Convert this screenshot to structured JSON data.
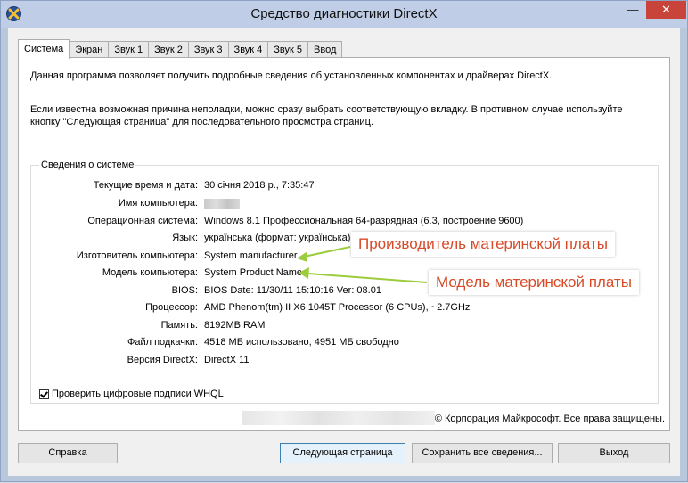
{
  "window": {
    "title": "Средство диагностики DirectX",
    "minimize_glyph": "—",
    "close_glyph": "✕"
  },
  "tabs": [
    {
      "label": "Система"
    },
    {
      "label": "Экран"
    },
    {
      "label": "Звук 1"
    },
    {
      "label": "Звук 2"
    },
    {
      "label": "Звук 3"
    },
    {
      "label": "Звук 4"
    },
    {
      "label": "Звук 5"
    },
    {
      "label": "Ввод"
    }
  ],
  "intro": {
    "line1": "Данная программа позволяет получить подробные сведения об установленных компонентах и драйверах DirectX.",
    "line2": "Если известна возможная причина неполадки, можно сразу выбрать соответствующую вкладку. В противном случае используйте кнопку \"Следующая страница\" для последовательного просмотра страниц."
  },
  "system_info": {
    "group_label": "Сведения о системе",
    "rows": [
      {
        "label": "Текущие время и дата:",
        "value": "30 січня 2018 р., 7:35:47"
      },
      {
        "label": "Имя компьютера:",
        "value": ""
      },
      {
        "label": "Операционная система:",
        "value": "Windows 8.1 Профессиональная 64-разрядная (6.3, построение 9600)"
      },
      {
        "label": "Язык:",
        "value": "українська (формат: українська)"
      },
      {
        "label": "Изготовитель компьютера:",
        "value": "System manufacturer"
      },
      {
        "label": "Модель компьютера:",
        "value": "System Product Name"
      },
      {
        "label": "BIOS:",
        "value": "BIOS Date: 11/30/11 15:10:16 Ver: 08.01"
      },
      {
        "label": "Процессор:",
        "value": "AMD Phenom(tm) II X6 1045T Processor (6 CPUs), ~2.7GHz"
      },
      {
        "label": "Память:",
        "value": "8192MB RAM"
      },
      {
        "label": "Файл подкачки:",
        "value": "4518 МБ использовано, 4951 МБ свободно"
      },
      {
        "label": "Версия DirectX:",
        "value": "DirectX 11"
      }
    ],
    "whql_label": "Проверить цифровые подписи WHQL",
    "whql_checked": true
  },
  "copyright": "© Корпорация Майкрософт. Все права защищены.",
  "buttons": {
    "help": "Справка",
    "next": "Следующая страница",
    "save": "Сохранить все сведения...",
    "exit": "Выход"
  },
  "annotations": {
    "manufacturer_callout": "Производитель материнской платы",
    "model_callout": "Модель материнской платы",
    "arrow_color": "#9ccc3c",
    "callout_text_color": "#d94a27"
  }
}
